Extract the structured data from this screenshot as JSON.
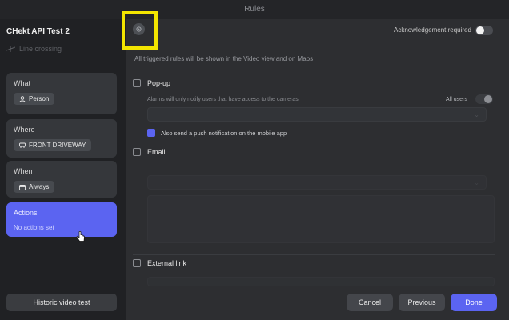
{
  "window": {
    "title": "Rules"
  },
  "sidebar": {
    "rule_name": "CHekt API Test 2",
    "rule_type": "Line crossing",
    "cards": {
      "what": {
        "label": "What",
        "chip": "Person"
      },
      "where": {
        "label": "Where",
        "chip": "FRONT DRIVEWAY"
      },
      "when": {
        "label": "When",
        "chip": "Always"
      },
      "actions": {
        "label": "Actions",
        "sub": "No actions set"
      }
    },
    "historic_button": "Historic video test"
  },
  "main": {
    "acknowledgement_label": "Acknowledgement required",
    "info_text": "All triggered rules will be shown in the Video view and on Maps",
    "popup": {
      "label": "Pop-up",
      "hint": "Alarms will only notify users that have access to the cameras",
      "all_users_label": "All users",
      "push_label": "Also send a push notification on the mobile app"
    },
    "email": {
      "label": "Email"
    },
    "external_link": {
      "label": "External link"
    }
  },
  "footer": {
    "cancel": "Cancel",
    "previous": "Previous",
    "done": "Done"
  },
  "colors": {
    "accent": "#5b64f1",
    "highlight": "#f3e500"
  }
}
